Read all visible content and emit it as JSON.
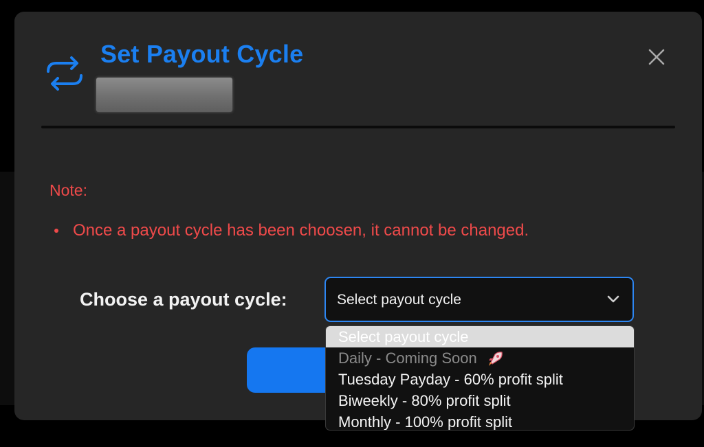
{
  "modal": {
    "title": "Set Payout Cycle",
    "title_color": "#1b7ff0"
  },
  "note": {
    "heading": "Note:",
    "items": [
      "Once a payout cycle has been choosen, it cannot be changed."
    ],
    "color": "#ef4a4a"
  },
  "form": {
    "label": "Choose a payout cycle:",
    "select_value": "Select payout cycle",
    "accent_color": "#2d86f2"
  },
  "dropdown": {
    "options": [
      {
        "label": "Select payout cycle",
        "state": "selected"
      },
      {
        "label": "Daily - Coming Soon",
        "state": "disabled",
        "icon": "rocket-icon"
      },
      {
        "label": "Tuesday Payday - 60% profit split",
        "state": "enabled"
      },
      {
        "label": "Biweekly - 80% profit split",
        "state": "enabled"
      },
      {
        "label": "Monthly - 100% profit split",
        "state": "enabled"
      }
    ]
  },
  "icons": {
    "header": "refresh-cycle-icon",
    "close": "close-icon",
    "select": "chevron-down-icon"
  }
}
